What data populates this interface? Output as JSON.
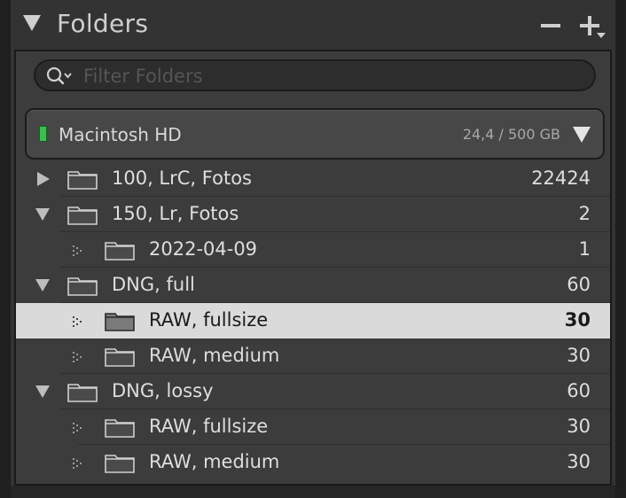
{
  "panel": {
    "title": "Folders",
    "remove_label": "−",
    "add_label": "+"
  },
  "search": {
    "placeholder": "Filter Folders",
    "value": ""
  },
  "volume": {
    "name": "Macintosh HD",
    "usage": "24,4 / 500 GB",
    "status_color": "#37c24a"
  },
  "folders": [
    {
      "name": "100, LrC, Fotos",
      "count": "22424",
      "level": 0,
      "expander": "closed"
    },
    {
      "name": "150, Lr, Fotos",
      "count": "2",
      "level": 0,
      "expander": "open"
    },
    {
      "name": "2022-04-09",
      "count": "1",
      "level": 1,
      "expander": "none"
    },
    {
      "name": "DNG, full",
      "count": "60",
      "level": 0,
      "expander": "open"
    },
    {
      "name": "RAW, fullsize",
      "count": "30",
      "level": 1,
      "expander": "none",
      "selected": true
    },
    {
      "name": "RAW, medium",
      "count": "30",
      "level": 1,
      "expander": "none"
    },
    {
      "name": "DNG, lossy",
      "count": "60",
      "level": 0,
      "expander": "open"
    },
    {
      "name": "RAW, fullsize",
      "count": "30",
      "level": 1,
      "expander": "none"
    },
    {
      "name": "RAW, medium",
      "count": "30",
      "level": 1,
      "expander": "none"
    }
  ]
}
